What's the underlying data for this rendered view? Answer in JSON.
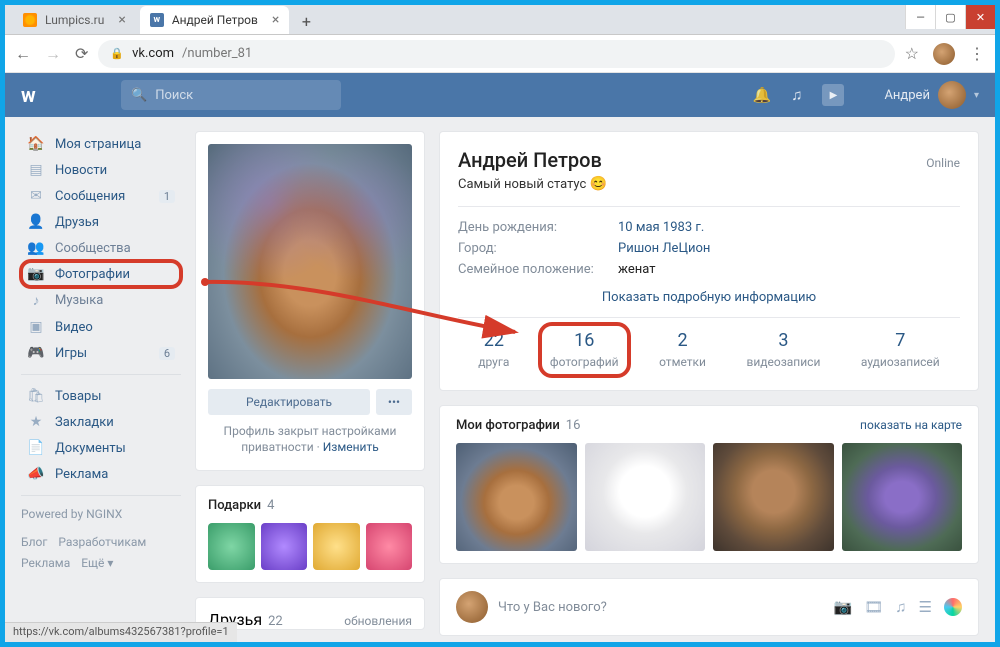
{
  "browser": {
    "tabs": [
      {
        "title": "Lumpics.ru"
      },
      {
        "title": "Андрей Петров"
      }
    ],
    "url_domain": "vk.com",
    "url_path": "/number_81",
    "status_bar": "https://vk.com/albums432567381?profile=1"
  },
  "vk_header": {
    "search_placeholder": "Поиск",
    "user_name": "Андрей"
  },
  "sidebar": {
    "items": [
      {
        "label": "Моя страница",
        "icon": "🏠"
      },
      {
        "label": "Новости",
        "icon": "📰"
      },
      {
        "label": "Сообщения",
        "icon": "💬",
        "badge": "1"
      },
      {
        "label": "Друзья",
        "icon": "👥"
      },
      {
        "label": "Сообщества",
        "icon": "👨‍👩‍👦"
      },
      {
        "label": "Фотографии",
        "icon": "📷"
      },
      {
        "label": "Музыка",
        "icon": "🎵"
      },
      {
        "label": "Видео",
        "icon": "🎞"
      },
      {
        "label": "Игры",
        "icon": "🎮",
        "badge": "6"
      },
      {
        "label": "Товары",
        "icon": "🛍"
      },
      {
        "label": "Закладки",
        "icon": "★"
      },
      {
        "label": "Документы",
        "icon": "📄"
      },
      {
        "label": "Реклама",
        "icon": "📢"
      }
    ],
    "powered": "Powered by NGINX",
    "footer": [
      "Блог",
      "Разработчикам",
      "Реклама",
      "Ещё ▾"
    ]
  },
  "profile_card": {
    "edit_btn": "Редактировать",
    "more_btn": "•••",
    "privacy_text": "Профиль закрыт настройками приватности · ",
    "privacy_link": "Изменить"
  },
  "gifts": {
    "title": "Подарки",
    "count": "4"
  },
  "friends_block": {
    "title": "Друзья",
    "count": "22",
    "updates": "обновления"
  },
  "profile_info": {
    "name": "Андрей Петров",
    "online": "Online",
    "status": "Самый новый статус",
    "rows": [
      {
        "label": "День рождения:",
        "value": "10 мая 1983 г."
      },
      {
        "label": "Город:",
        "value": "Ришон ЛеЦион"
      },
      {
        "label": "Семейное положение:",
        "value": "женат"
      }
    ],
    "show_more": "Показать подробную информацию",
    "counters": [
      {
        "num": "22",
        "lbl": "друга"
      },
      {
        "num": "16",
        "lbl": "фотографий"
      },
      {
        "num": "2",
        "lbl": "отметки"
      },
      {
        "num": "3",
        "lbl": "видеозаписи"
      },
      {
        "num": "7",
        "lbl": "аудиозаписей"
      }
    ]
  },
  "photos_block": {
    "title": "Мои фотографии",
    "count": "16",
    "show_map": "показать на карте"
  },
  "post_block": {
    "placeholder": "Что у Вас нового?"
  }
}
